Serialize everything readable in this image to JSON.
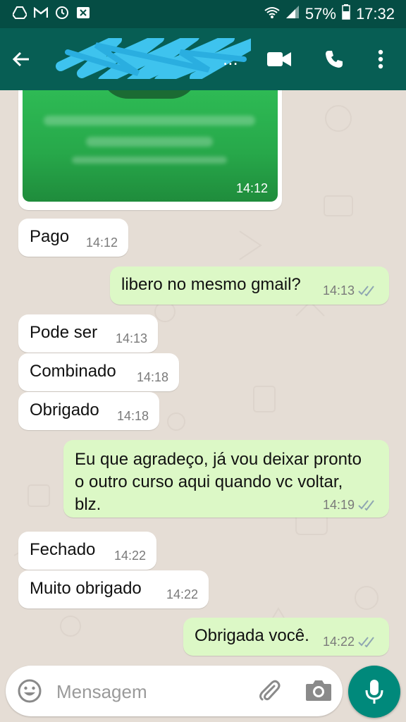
{
  "status_bar": {
    "battery_percent": "57%",
    "time": "17:32"
  },
  "header": {
    "contact_name": "...",
    "icons": [
      "back-arrow-icon",
      "video-call-icon",
      "phone-icon",
      "more-options-icon"
    ]
  },
  "image_message": {
    "time": "14:12"
  },
  "messages": [
    {
      "dir": "in",
      "text": "Pago",
      "time": "14:12"
    },
    {
      "dir": "out",
      "text": "libero no mesmo gmail?",
      "time": "14:13"
    },
    {
      "dir": "in",
      "text": "Pode ser",
      "time": "14:13"
    },
    {
      "dir": "in",
      "text": "Combinado",
      "time": "14:18"
    },
    {
      "dir": "in",
      "text": "Obrigado",
      "time": "14:18"
    },
    {
      "dir": "out",
      "lines": [
        "Eu que agradeço, já vou deixar pronto",
        "o outro curso aqui quando vc voltar,",
        "blz."
      ],
      "time": "14:19"
    },
    {
      "dir": "in",
      "text": "Fechado",
      "time": "14:22"
    },
    {
      "dir": "in",
      "text": "Muito obrigado",
      "time": "14:22"
    },
    {
      "dir": "out",
      "text": "Obrigada você.",
      "time": "14:22"
    }
  ],
  "composer": {
    "placeholder": "Mensagem"
  },
  "colors": {
    "header": "#075e54",
    "status_bar": "#054d44",
    "outgoing_bubble": "#dcf8c6",
    "incoming_bubble": "#ffffff",
    "read_ticks": "#8fa6b2",
    "mic_button": "#00897b"
  }
}
